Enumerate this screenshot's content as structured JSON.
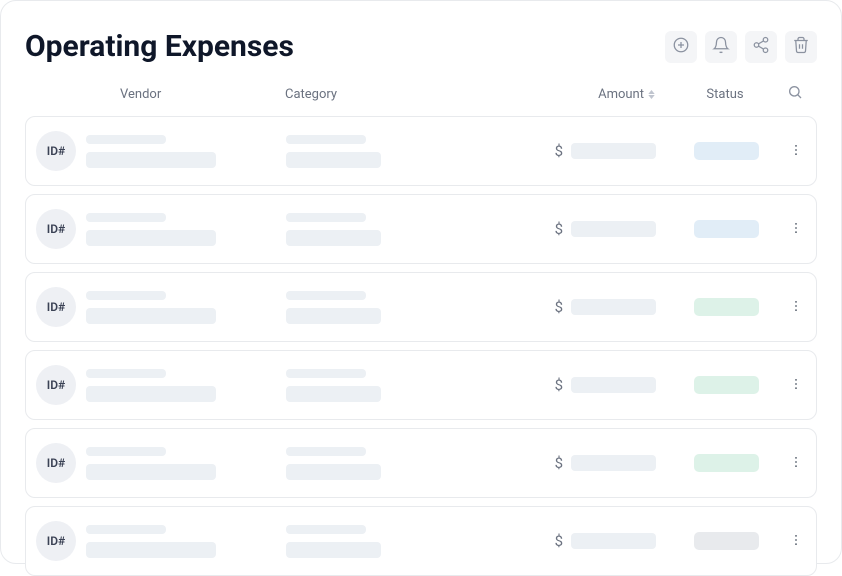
{
  "header": {
    "title": "Operating Expenses"
  },
  "columns": {
    "vendor": "Vendor",
    "category": "Category",
    "amount": "Amount",
    "status": "Status"
  },
  "currency_symbol": "$",
  "id_badge_text": "ID#",
  "rows": [
    {
      "status_class": "status-blue"
    },
    {
      "status_class": "status-blue"
    },
    {
      "status_class": "status-green"
    },
    {
      "status_class": "status-green"
    },
    {
      "status_class": "status-green"
    },
    {
      "status_class": "status-grey"
    }
  ]
}
